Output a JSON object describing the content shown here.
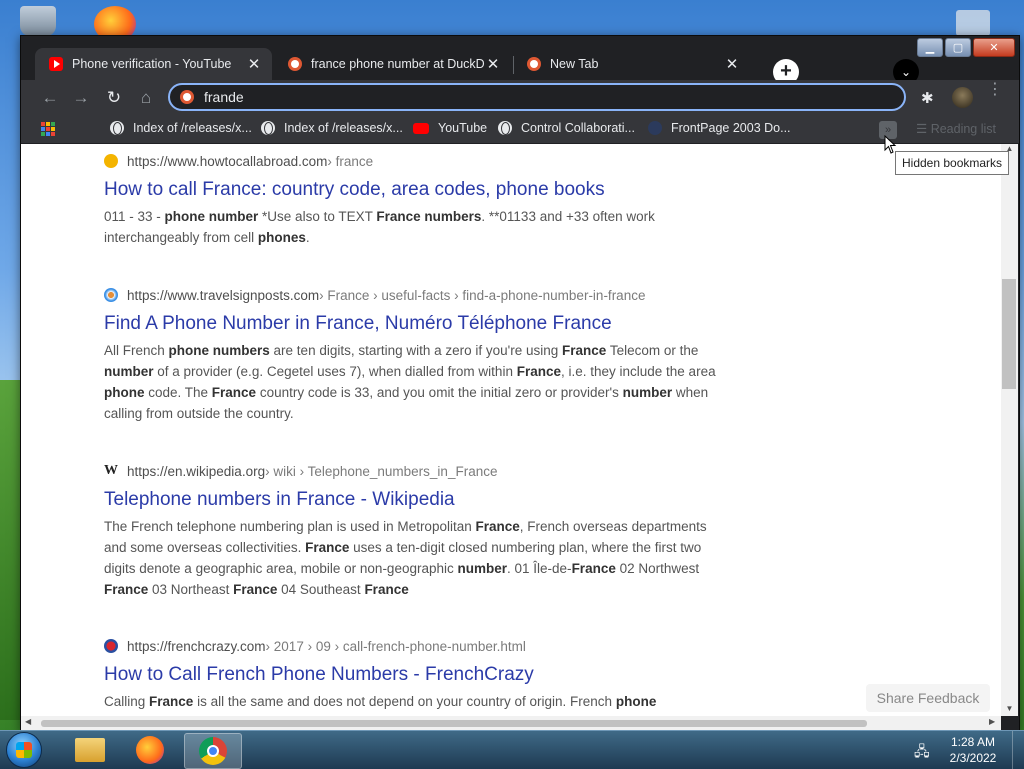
{
  "desktop": {
    "recycle_icon": "recycle-bin-icon",
    "firefox_icon": "firefox-icon"
  },
  "window": {
    "controls": {
      "minimize": "▁",
      "maximize": "▢",
      "close": "✕"
    }
  },
  "tabs": [
    {
      "title": "Phone verification - YouTube",
      "icon": "youtube-icon",
      "active": true
    },
    {
      "title": "france phone number at DuckDuckGo",
      "icon": "duckduckgo-icon",
      "active": false
    },
    {
      "title": "New Tab",
      "icon": "duckduckgo-icon",
      "active": false
    }
  ],
  "tab_close_glyph": "✕",
  "new_tab_glyph": "+",
  "tab_search_glyph": "⌄",
  "toolbar": {
    "back": "←",
    "forward": "→",
    "reload": "↻",
    "home": "⌂",
    "omnibox_value": "frande",
    "extensions_glyph": "✱",
    "menu_glyph": "⋮"
  },
  "bookmarks": [
    {
      "label": "Index of /releases/x...",
      "icon": "globe-icon"
    },
    {
      "label": "Index of /releases/x...",
      "icon": "globe-icon"
    },
    {
      "label": "YouTube",
      "icon": "youtube-icon"
    },
    {
      "label": "Control Collaborati...",
      "icon": "globe-icon"
    },
    {
      "label": "FrontPage 2003 Do...",
      "icon": "frontpage-icon"
    }
  ],
  "bookmarks_more_glyph": "»",
  "reading_list_label": "Reading list",
  "tooltip": "Hidden bookmarks",
  "results": [
    {
      "domain": "https://www.howtocallabroad.com",
      "path": " › france",
      "title": "How to call France: country code, area codes, phone books",
      "snippet_html": "011 - 33 - <b>phone number</b> *Use also to TEXT <b>France numbers</b>. **01133 and +33 often work interchangeably from cell <b>phones</b>."
    },
    {
      "domain": "https://www.travelsignposts.com",
      "path": " › France › useful-facts › find-a-phone-number-in-france",
      "title": "Find A Phone Number in France, Numéro Téléphone France",
      "snippet_html": "All French <b>phone numbers</b> are ten digits, starting with a zero if you're using <b>France</b> Telecom or the <b>number</b> of a provider (e.g. Cegetel uses 7), when dialled from within <b>France</b>, i.e. they include the area <b>phone</b> code. The <b>France</b> country code is 33, and you omit the initial zero or provider's <b>number</b> when calling from outside the country."
    },
    {
      "domain": "https://en.wikipedia.org",
      "path": " › wiki › Telephone_numbers_in_France",
      "title": "Telephone numbers in France - Wikipedia",
      "snippet_html": "The French telephone numbering plan is used in Metropolitan <b>France</b>, French overseas departments and some overseas collectivities. <b>France</b> uses a ten-digit closed numbering plan, where the first two digits denote a geographic area, mobile or non-geographic <b>number</b>. 01 Île-de-<b>France</b> 02 Northwest <b>France</b> 03 Northeast <b>France</b> 04 Southeast <b>France</b>"
    },
    {
      "domain": "https://frenchcrazy.com",
      "path": " › 2017 › 09 › call-french-phone-number.html",
      "title": "How to Call French Phone Numbers - FrenchCrazy",
      "snippet_html": "Calling <b>France</b> is all the same and does not depend on your country of origin. French <b>phone</b>"
    }
  ],
  "wiki_fav_glyph": "W",
  "share_feedback": "Share Feedback",
  "taskbar": {
    "time": "1:28 AM",
    "date": "2/3/2022",
    "network_glyph": "🖧"
  },
  "colors": {
    "link": "#2b3ba8",
    "tab_active": "#35363a",
    "chrome_dark": "#202124",
    "focus_ring": "#8ab4f8"
  }
}
